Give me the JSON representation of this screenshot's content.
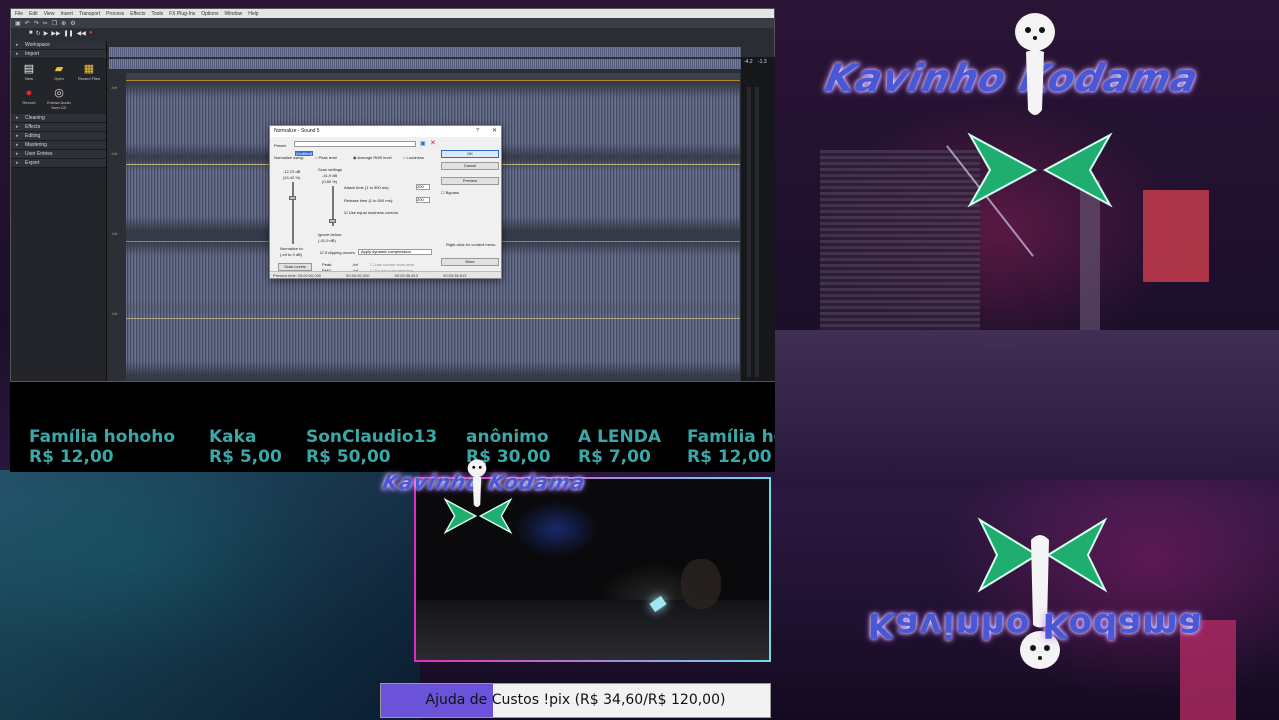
{
  "daw": {
    "menu": [
      "File",
      "Edit",
      "View",
      "Insert",
      "Transport",
      "Process",
      "Effects",
      "Tools",
      "FX Plug-Ins",
      "Options",
      "Window",
      "Help"
    ],
    "panel": {
      "sections": [
        "Workspace",
        "Import"
      ],
      "tools": [
        {
          "label": "New",
          "icon": "document-icon"
        },
        {
          "label": "Open",
          "icon": "folder-icon"
        },
        {
          "label": "Recent Files",
          "icon": "recent-files-icon"
        },
        {
          "label": "Record",
          "icon": "record-icon"
        },
        {
          "label": "Extract Audio from CD",
          "icon": "cd-icon"
        }
      ],
      "groups": [
        "Cleaning",
        "Effects",
        "Editing",
        "Mastering",
        "User Entries",
        "Export"
      ]
    },
    "meter": {
      "left": "-4.2",
      "right": "-1.3"
    }
  },
  "dialog": {
    "title": "Normalize - Sound 5",
    "help": "?",
    "preset_label": "Preset:",
    "preset_value": "(Untitled)",
    "normalize_using": "Normalize using:",
    "mode_peak": "Peak level",
    "mode_rms": "Average RMS level",
    "mode_loudness": "Loudness",
    "level_value": "-12,23 dB",
    "level_pct": "(24,42 %)",
    "scan_settings": "Scan settings",
    "scan_value": "-41,9 dB",
    "scan_pct": "(0,80 %)",
    "attack_label": "Attack time (1 to 500 ms):",
    "attack_value": "200",
    "release_label": "Release time (1 to 500 ms):",
    "release_value": "200",
    "equal_loudness": "Use equal loudness contour",
    "ignore_below": "Ignore below:",
    "ignore_value": "(-41,9 dB)",
    "normalize_to": "Normalize to:",
    "normalize_range": "(-inf to 0 dB)",
    "if_clipping": "If clipping occurs:",
    "clipping_option": "Apply dynamic compression",
    "scan_levels": "Scan Levels",
    "peak_label": "Peak:",
    "peak_value": "-Inf",
    "rms_label": "RMS:",
    "rms_value": "-Inf",
    "use_current": "Use current scan level",
    "scan_selection": "Do not scan selection",
    "btn_ok": "OK",
    "btn_cancel": "Cancel",
    "btn_preview": "Preview",
    "bypass": "Bypass",
    "hint": "Right-click for context menu.",
    "btn_more": "More",
    "status_preview": "Preview limit: 00:00:00,000",
    "status_a": "00:00:00,000",
    "status_b": "00:03:36,813",
    "status_c": "00:03:36,813"
  },
  "donations": [
    {
      "name": "Família hohoho",
      "amount": "R$ 12,00"
    },
    {
      "name": "Kaka",
      "amount": "R$ 5,00"
    },
    {
      "name": "SonClaudio13",
      "amount": "R$ 50,00"
    },
    {
      "name": "anônimo",
      "amount": "R$ 30,00"
    },
    {
      "name": "A LENDA",
      "amount": "R$ 7,00"
    },
    {
      "name": "Família hohoho",
      "amount": "R$ 12,00"
    }
  ],
  "goal": {
    "text": "Ajuda de Custos !pix (R$ 34,60/R$ 120,00)",
    "current": 34.6,
    "target": 120,
    "fill_color": "#6a53d8"
  },
  "colors": {
    "donation_text": "#3aa7a8",
    "logo_blue": "#4a57d6",
    "chevron_green": "#1fae70",
    "webcam_border": "#e22cc0"
  }
}
